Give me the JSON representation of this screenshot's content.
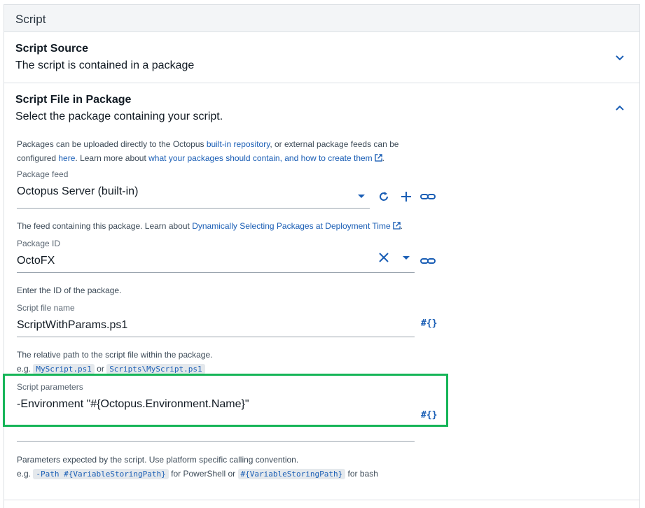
{
  "section": {
    "title": "Script"
  },
  "script_source": {
    "title": "Script Source",
    "summary": "The script is contained in a package"
  },
  "script_file": {
    "title": "Script File in Package",
    "summary": "Select the package containing your script.",
    "intro": {
      "t1": "Packages can be uploaded directly to the Octopus ",
      "link1": "built-in repository",
      "t2": ", or external package feeds can be",
      "t3": "configured ",
      "link2": "here",
      "t4": ". Learn more about ",
      "link3": "what your packages should contain, and how to create them"
    },
    "package_feed": {
      "label": "Package feed",
      "value": "Octopus Server (built-in)",
      "help_text": "The feed containing this package. Learn about ",
      "help_link": "Dynamically Selecting Packages at Deployment Time",
      "help_end": "."
    },
    "package_id": {
      "label": "Package ID",
      "value": "OctoFX",
      "help": "Enter the ID of the package."
    },
    "script_file_name": {
      "label": "Script file name",
      "value": "ScriptWithParams.ps1",
      "help": "The relative path to the script file within the package.",
      "eg": "e.g. ",
      "example1": "MyScript.ps1",
      "or": " or ",
      "example2": "Scripts\\MyScript.ps1"
    },
    "script_parameters": {
      "label": "Script parameters",
      "value": "-Environment \"#{Octopus.Environment.Name}\"",
      "help": "Parameters expected by the script. Use platform specific calling convention.",
      "eg": "e.g. ",
      "example1": "-Path #{VariableStoringPath}",
      "mid": " for PowerShell or ",
      "example2": "#{VariableStoringPath}",
      "end": " for bash"
    },
    "variable_button_label": "#{}"
  },
  "colors": {
    "accent": "#1a5eb5",
    "highlight": "#16b558",
    "border": "#dde1e5"
  }
}
